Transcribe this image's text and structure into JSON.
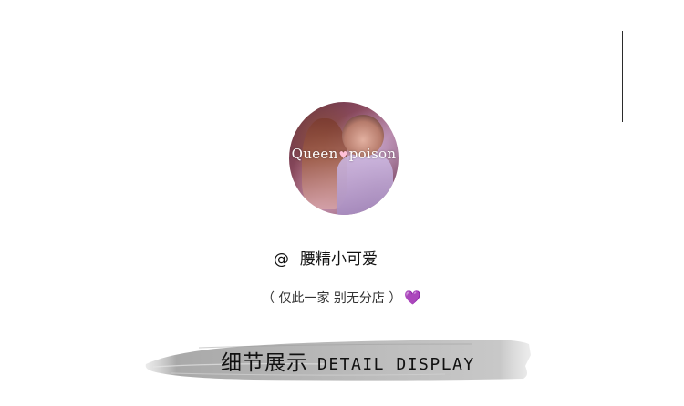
{
  "avatar": {
    "overlay_text_left": "Queen",
    "overlay_heart": "♥",
    "overlay_text_right": "poison"
  },
  "shop": {
    "at_symbol": "@",
    "name": "腰精小可爱"
  },
  "tagline": {
    "text": "（ 仅此一家 别无分店  ）",
    "heart_icon": "💜",
    "heart_color": "#9b4dd8"
  },
  "section_header": {
    "title_cn": "细节展示",
    "title_en": "DETAIL DISPLAY"
  },
  "colors": {
    "line": "#2b2b2b",
    "brush": "#bdbdbd",
    "text": "#111111"
  }
}
